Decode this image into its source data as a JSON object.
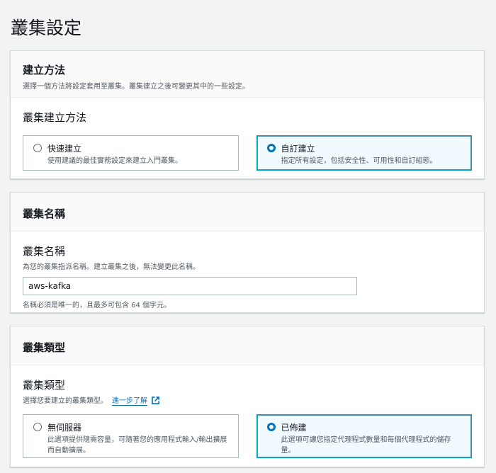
{
  "page_title": "叢集設定",
  "creation": {
    "title": "建立方法",
    "subtitle": "選擇一個方法將設定套用至叢集。叢集建立之後可變更其中的一些設定。",
    "label": "叢集建立方法",
    "options": [
      {
        "name": "快速建立",
        "desc": "使用建議的最佳實務設定來建立入門叢集。",
        "selected": false
      },
      {
        "name": "自訂建立",
        "desc": "指定所有設定，包括安全性、可用性和自訂組態。",
        "selected": true
      }
    ]
  },
  "name_section": {
    "title": "叢集名稱",
    "label": "叢集名稱",
    "desc": "為您的叢集指派名稱。建立叢集之後，無法變更此名稱。",
    "value": "aws-kafka",
    "hint": "名稱必須是唯一的，且最多可包含 64 個字元。"
  },
  "type_section": {
    "title": "叢集類型",
    "label": "叢集類型",
    "desc": "選擇您要建立的叢集類型。",
    "learn_more": "進一步了解",
    "options": [
      {
        "name": "無伺服器",
        "desc": "此選項提供隨需容量，可隨著您的應用程式輸入/輸出擴展而自動擴展。",
        "selected": false
      },
      {
        "name": "已佈建",
        "desc": "此選項可讓您指定代理程式數量和每個代理程式的儲存量。",
        "selected": true
      }
    ]
  }
}
